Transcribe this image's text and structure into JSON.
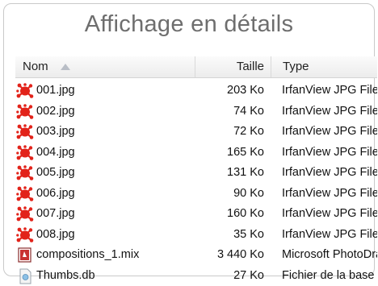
{
  "title": "Affichage en détails",
  "columns": {
    "name": "Nom",
    "size": "Taille",
    "type": "Type"
  },
  "files": [
    {
      "name": "001.jpg",
      "size": "203 Ko",
      "type": "IrfanView JPG File",
      "icon": "irfanview-jpg-icon"
    },
    {
      "name": "002.jpg",
      "size": "74 Ko",
      "type": "IrfanView JPG File",
      "icon": "irfanview-jpg-icon"
    },
    {
      "name": "003.jpg",
      "size": "72 Ko",
      "type": "IrfanView JPG File",
      "icon": "irfanview-jpg-icon"
    },
    {
      "name": "004.jpg",
      "size": "165 Ko",
      "type": "IrfanView JPG File",
      "icon": "irfanview-jpg-icon"
    },
    {
      "name": "005.jpg",
      "size": "131 Ko",
      "type": "IrfanView JPG File",
      "icon": "irfanview-jpg-icon"
    },
    {
      "name": "006.jpg",
      "size": "90 Ko",
      "type": "IrfanView JPG File",
      "icon": "irfanview-jpg-icon"
    },
    {
      "name": "007.jpg",
      "size": "160 Ko",
      "type": "IrfanView JPG File",
      "icon": "irfanview-jpg-icon"
    },
    {
      "name": "008.jpg",
      "size": "35 Ko",
      "type": "IrfanView JPG File",
      "icon": "irfanview-jpg-icon"
    },
    {
      "name": "compositions_1.mix",
      "size": "3 440 Ko",
      "type": "Microsoft PhotoDra...",
      "icon": "photodraw-mix-icon"
    },
    {
      "name": "Thumbs.db",
      "size": "27 Ko",
      "type": "Fichier de la base d...",
      "icon": "thumbs-db-icon"
    }
  ],
  "colors": {
    "irfanview": "#e2231a",
    "header_text": "#222222",
    "title": "#6e6e6e"
  }
}
